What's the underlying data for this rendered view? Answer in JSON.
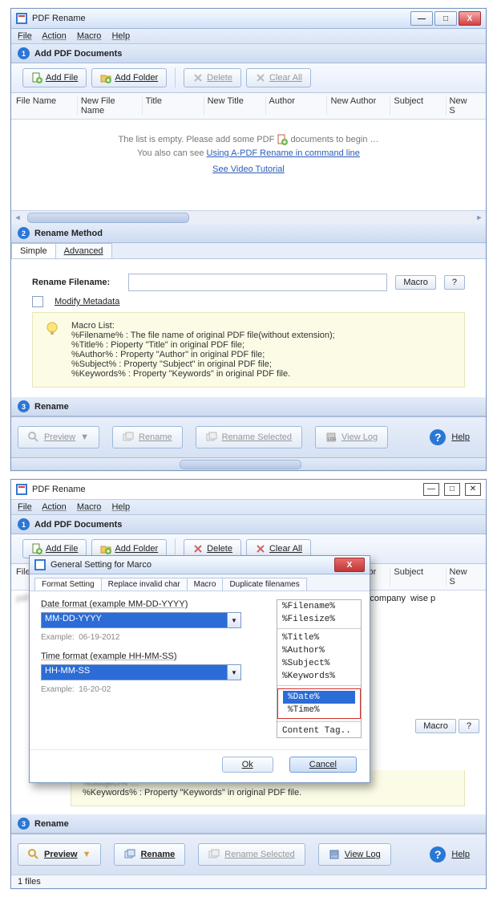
{
  "top_window": {
    "title": "PDF Rename",
    "menu": [
      "File",
      "Action",
      "Macro",
      "Help"
    ],
    "step1": {
      "num": "1",
      "label": "Add PDF Documents"
    },
    "toolbar": {
      "add_file": "Add File",
      "add_folder": "Add Folder",
      "delete": "Delete",
      "clear_all": "Clear All"
    },
    "columns": [
      "File Name",
      "New File Name",
      "Title",
      "New Title",
      "Author",
      "New Author",
      "Subject",
      "New S"
    ],
    "empty": {
      "line1a": "The list is empty. Please add some PDF",
      "line1b": " documents to begin …",
      "line2": "You also can see  ",
      "link1": "Using A-PDF Rename  in command line",
      "link2": "See Video Tutorial "
    },
    "step2": {
      "num": "2",
      "label": "Rename Method"
    },
    "tabs": {
      "simple": "Simple",
      "advanced": "Advanced"
    },
    "rename_label": "Rename Filename:",
    "rename_value": "",
    "macro_btn": "Macro",
    "help_q": "?",
    "modify_metadata": "Modify Metadata",
    "macro_hint": {
      "title": "Macro List:",
      "l1": "%Filename%  : The file name of original PDF file(without extension);",
      "l2": "%Title%     : Pioperty \"Title\" in original PDF file;",
      "l3": "%Author%   : Property \"Author\" in original PDF file;",
      "l4": "%Subject%  : Property \"Subject\" in original PDF file;",
      "l5": "%Keywords%  : Property \"Keywords\" in original PDF file."
    },
    "step3": {
      "num": "3",
      "label": "Rename"
    },
    "bottom": {
      "preview": "Preview",
      "rename": "Rename",
      "rename_sel": "Rename Selected",
      "view_log": "View Log",
      "help": "Help"
    }
  },
  "bottom_window": {
    "title": "PDF Rename",
    "step1": {
      "num": "1",
      "label": "Add PDF Documents"
    },
    "toolbar": {
      "add_file": "Add File",
      "add_folder": "Add Folder",
      "delete": "Delete",
      "clear_all": "Clear All"
    },
    "columns": [
      "File Name",
      "New File Name",
      "Title",
      "New Title",
      "Author",
      "New Author",
      "Subject",
      "New S"
    ],
    "row_cells": {
      "c6": "mpany",
      "c7": "wise pdf company",
      "c8": "wise p"
    },
    "keywords_line": "%Keywords%  : Property \"Keywords\" in original PDF file.",
    "rename_label": "",
    "macro_btn": "Macro",
    "help_q": "?",
    "step3": {
      "num": "3",
      "label": "Rename"
    },
    "bottom": {
      "preview": "Preview",
      "rename": "Rename",
      "rename_sel": "Rename Selected",
      "view_log": "View Log",
      "help": "Help"
    },
    "status": "1 files"
  },
  "dialog": {
    "title": "General Setting for Marco",
    "tabs": [
      "Format Setting",
      "Replace invalid char",
      "Macro",
      "Duplicate filenames"
    ],
    "date_label": "Date format (example MM-DD-YYYY)",
    "date_value": "MM-DD-YYYY",
    "date_example_lbl": "Example:",
    "date_example_val": "06-19-2012",
    "time_label": "Time format (example HH-MM-SS)",
    "time_value": "HH-MM-SS",
    "time_example_lbl": "Example:",
    "time_example_val": "16-20-02",
    "list": [
      "%Filename%",
      "%Filesize%",
      "%Title%",
      "%Author%",
      "%Subject%",
      "%Keywords%",
      "%Date%",
      "%Time%",
      "Content Tag.."
    ],
    "ok": "Ok",
    "cancel": "Cancel"
  }
}
